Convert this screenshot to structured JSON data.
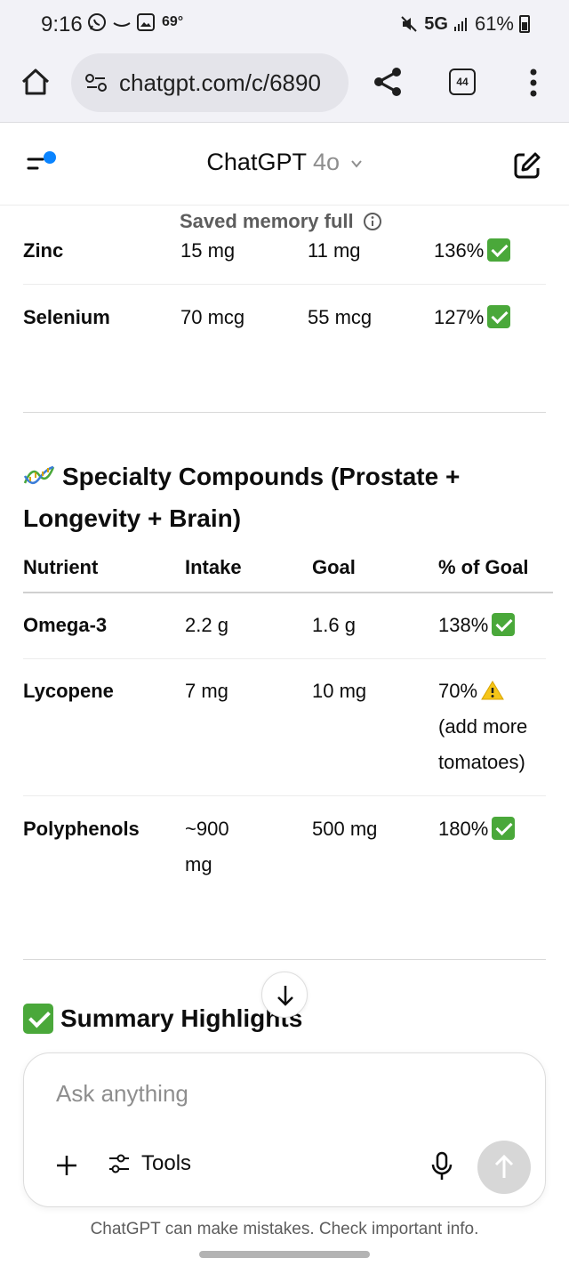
{
  "status_bar": {
    "time": "9:16",
    "temperature": "69°",
    "network": "5G",
    "battery": "61%"
  },
  "browser": {
    "url": "chatgpt.com/c/6890",
    "tab_count": "44"
  },
  "header": {
    "title": "ChatGPT",
    "model": "4o"
  },
  "memory_note": "Saved memory full",
  "minerals_rows": [
    {
      "name": "Zinc",
      "intake": "15 mg",
      "goal": "11 mg",
      "percent": "136%",
      "status": "check"
    },
    {
      "name": "Selenium",
      "intake": "70 mcg",
      "goal": "55 mcg",
      "percent": "127%",
      "status": "check"
    }
  ],
  "specialty": {
    "heading": "Specialty Compounds (Prostate + Longevity + Brain)",
    "icon": "dna-icon",
    "columns": [
      "Nutrient",
      "Intake",
      "Goal",
      "% of Goal"
    ],
    "rows": [
      {
        "name": "Omega-3",
        "intake": "2.2 g",
        "goal": "1.6 g",
        "percent": "138%",
        "status": "check"
      },
      {
        "name": "Lycopene",
        "intake": "7 mg",
        "goal": "10 mg",
        "percent": "70%",
        "status": "warning",
        "note": "(add more tomatoes)"
      },
      {
        "name": "Polyphenols",
        "intake": "~900 mg",
        "goal": "500 mg",
        "percent": "180%",
        "status": "check"
      }
    ]
  },
  "summary": {
    "heading": "Summary Highlights",
    "icon": "check-mark-icon"
  },
  "composer": {
    "placeholder": "Ask anything",
    "tools_label": "Tools"
  },
  "disclaimer": "ChatGPT can make mistakes. Check important info.",
  "colors": {
    "check_green": "#4aa83a",
    "warning_yellow": "#f5c518",
    "accent_blue": "#0a84ff",
    "send_disabled": "#d7d7d7"
  }
}
